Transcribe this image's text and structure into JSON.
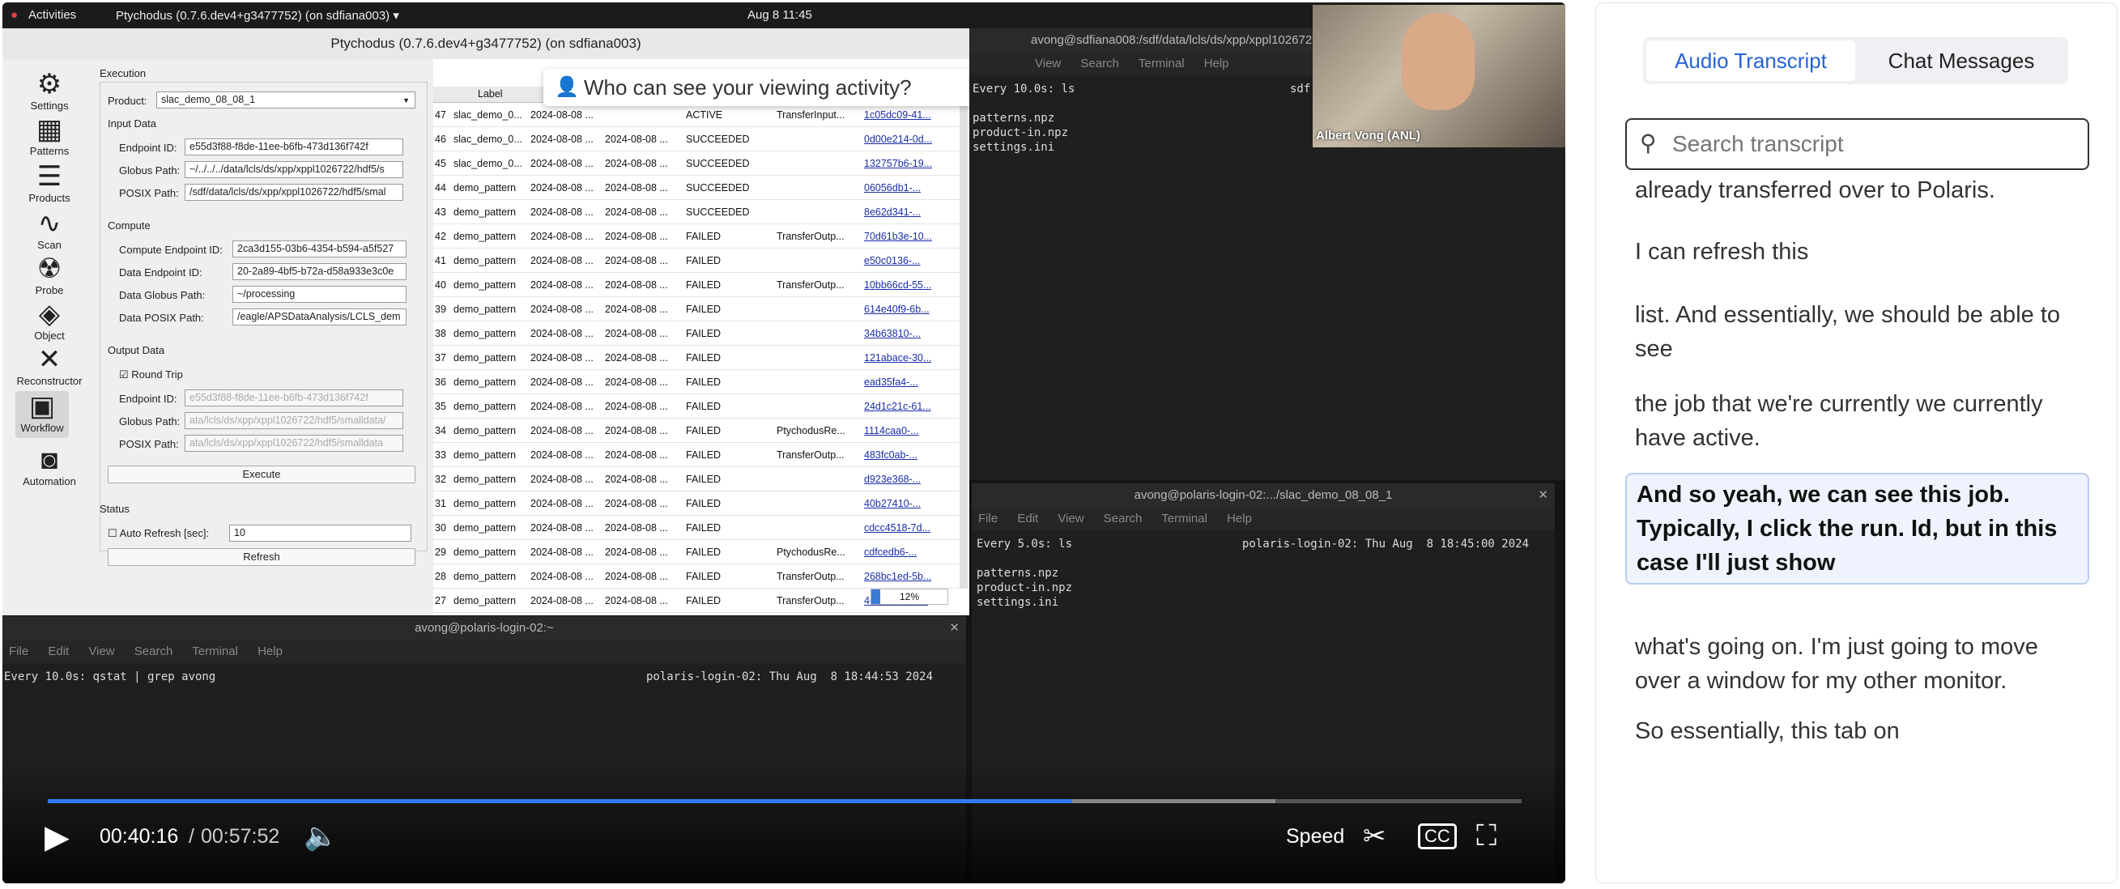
{
  "topbar": {
    "activities": "Activities",
    "app_menu": "Ptychodus (0.7.6.dev4+g3477752) (on sdfiana003) ▾",
    "clock": "Aug 8  11:45"
  },
  "app": {
    "title": "Ptychodus (0.7.6.dev4+g3477752) (on sdfiana003)",
    "sidebar": [
      {
        "label": "Settings",
        "icon": "gear-icon"
      },
      {
        "label": "Patterns",
        "icon": "grid-icon"
      },
      {
        "label": "Products",
        "icon": "list-icon"
      },
      {
        "label": "Scan",
        "icon": "scan-path-icon"
      },
      {
        "label": "Probe",
        "icon": "radiation-icon"
      },
      {
        "label": "Object",
        "icon": "layers-icon"
      },
      {
        "label": "Reconstructor",
        "icon": "tools-icon"
      },
      {
        "label": "Workflow",
        "icon": "briefcase-icon"
      },
      {
        "label": "Automation",
        "icon": "robot-icon"
      }
    ],
    "form": {
      "execution": "Execution",
      "product_label": "Product:",
      "product_value": "slac_demo_08_08_1",
      "input_data": "Input Data",
      "endpoint_id_label": "Endpoint ID:",
      "endpoint_id": "e55d3f88-f8de-11ee-b6fb-473d136f742f",
      "globus_path_label": "Globus Path:",
      "globus_path": "~/../../../data/lcls/ds/xpp/xppl1026722/hdf5/s",
      "posix_path_label": "POSIX Path:",
      "posix_path": "/sdf/data/lcls/ds/xpp/xppl1026722/hdf5/smal",
      "compute": "Compute",
      "compute_endpoint_label": "Compute Endpoint ID:",
      "compute_endpoint": "2ca3d155-03b6-4354-b594-a5f527",
      "data_endpoint_label": "Data Endpoint ID:",
      "data_endpoint": "20-2a89-4bf5-b72a-d58a933e3c0e",
      "data_globus_label": "Data Globus Path:",
      "data_globus": "~/processing",
      "data_posix_label": "Data POSIX Path:",
      "data_posix": "/eagle/APSDataAnalysis/LCLS_dem",
      "output_data": "Output Data",
      "round_trip": "Round Trip",
      "out_endpoint_label": "Endpoint ID:",
      "out_endpoint": "e55d3f88-f8de-11ee-b6fb-473d136f742f",
      "out_globus_label": "Globus Path:",
      "out_globus": "ata/lcls/ds/xpp/xppl1026722/hdf5/smalldata/",
      "out_posix_label": "POSIX Path:",
      "out_posix": "ata/lcls/ds/xpp/xppl1026722/hdf5/smalldata",
      "execute": "Execute",
      "status": "Status",
      "auto_refresh": "Auto Refresh [sec]:",
      "auto_refresh_value": "10",
      "refresh": "Refresh"
    },
    "table": {
      "header_label": "Label",
      "progress": "12%",
      "rows": [
        [
          "47",
          "slac_demo_0...",
          "2024-08-08 ...",
          "",
          "ACTIVE",
          "TransferInput...",
          "1c05dc09-41..."
        ],
        [
          "46",
          "slac_demo_0...",
          "2024-08-08 ...",
          "2024-08-08 ...",
          "SUCCEEDED",
          "",
          "0d00e214-0d..."
        ],
        [
          "45",
          "slac_demo_0...",
          "2024-08-08 ...",
          "2024-08-08 ...",
          "SUCCEEDED",
          "",
          "132757b6-19..."
        ],
        [
          "44",
          "demo_pattern",
          "2024-08-08 ...",
          "2024-08-08 ...",
          "SUCCEEDED",
          "",
          "06056db1-..."
        ],
        [
          "43",
          "demo_pattern",
          "2024-08-08 ...",
          "2024-08-08 ...",
          "SUCCEEDED",
          "",
          "8e62d341-..."
        ],
        [
          "42",
          "demo_pattern",
          "2024-08-08 ...",
          "2024-08-08 ...",
          "FAILED",
          "TransferOutp...",
          "70d61b3e-10..."
        ],
        [
          "41",
          "demo_pattern",
          "2024-08-08 ...",
          "2024-08-08 ...",
          "FAILED",
          "",
          "e50c0136-..."
        ],
        [
          "40",
          "demo_pattern",
          "2024-08-08 ...",
          "2024-08-08 ...",
          "FAILED",
          "TransferOutp...",
          "10bb66cd-55..."
        ],
        [
          "39",
          "demo_pattern",
          "2024-08-08 ...",
          "2024-08-08 ...",
          "FAILED",
          "",
          "614e40f9-6b..."
        ],
        [
          "38",
          "demo_pattern",
          "2024-08-08 ...",
          "2024-08-08 ...",
          "FAILED",
          "",
          "34b63810-..."
        ],
        [
          "37",
          "demo_pattern",
          "2024-08-08 ...",
          "2024-08-08 ...",
          "FAILED",
          "",
          "121abace-30..."
        ],
        [
          "36",
          "demo_pattern",
          "2024-08-08 ...",
          "2024-08-08 ...",
          "FAILED",
          "",
          "ead35fa4-..."
        ],
        [
          "35",
          "demo_pattern",
          "2024-08-08 ...",
          "2024-08-08 ...",
          "FAILED",
          "",
          "24d1c21c-61..."
        ],
        [
          "34",
          "demo_pattern",
          "2024-08-08 ...",
          "2024-08-08 ...",
          "FAILED",
          "PtychodusRe...",
          "1114caa0-..."
        ],
        [
          "33",
          "demo_pattern",
          "2024-08-08 ...",
          "2024-08-08 ...",
          "FAILED",
          "TransferOutp...",
          "483fc0ab-..."
        ],
        [
          "32",
          "demo_pattern",
          "2024-08-08 ...",
          "2024-08-08 ...",
          "FAILED",
          "",
          "d923e368-..."
        ],
        [
          "31",
          "demo_pattern",
          "2024-08-08 ...",
          "2024-08-08 ...",
          "FAILED",
          "",
          "40b27410-..."
        ],
        [
          "30",
          "demo_pattern",
          "2024-08-08 ...",
          "2024-08-08 ...",
          "FAILED",
          "",
          "cdcc4518-7d..."
        ],
        [
          "29",
          "demo_pattern",
          "2024-08-08 ...",
          "2024-08-08 ...",
          "FAILED",
          "PtychodusRe...",
          "cdfcedb6-..."
        ],
        [
          "28",
          "demo_pattern",
          "2024-08-08 ...",
          "2024-08-08 ...",
          "FAILED",
          "TransferOutp...",
          "268bc1ed-5b..."
        ],
        [
          "27",
          "demo_pattern",
          "2024-08-08 ...",
          "2024-08-08 ...",
          "FAILED",
          "TransferOutp...",
          "4612d9cf-2c..."
        ]
      ]
    }
  },
  "popup": {
    "text": "Who can see your viewing activity?",
    "close": "✕"
  },
  "term_top": {
    "title": "avong@sdfiana008:/sdf/data/lcls/ds/xpp/xppl1026722/",
    "menu": [
      "View",
      "Search",
      "Terminal",
      "Help"
    ],
    "command": "Every 10.0s: ls",
    "host": "sdf",
    "output": "patterns.npz\nproduct-in.npz\nsettings.ini"
  },
  "term_right": {
    "title": "avong@polaris-login-02:.../slac_demo_08_08_1",
    "menu": [
      "File",
      "Edit",
      "View",
      "Search",
      "Terminal",
      "Help"
    ],
    "command": "Every 5.0s: ls",
    "timestamp": "polaris-login-02: Thu Aug  8 18:45:00 2024",
    "output": "patterns.npz\nproduct-in.npz\nsettings.ini"
  },
  "term_bottom": {
    "title": "avong@polaris-login-02:~",
    "menu": [
      "File",
      "Edit",
      "View",
      "Search",
      "Terminal",
      "Help"
    ],
    "command": "Every 10.0s: qstat | grep avong",
    "timestamp": "polaris-login-02: Thu Aug  8 18:44:53 2024"
  },
  "webcam": {
    "name": "Albert Vong (ANL)"
  },
  "player": {
    "current": "00:40:16",
    "separator": "/",
    "duration": "00:57:52",
    "speed": "Speed",
    "progress_fraction": 0.695,
    "buffered_fraction": 0.833
  },
  "transcript": {
    "tab_audio": "Audio Transcript",
    "tab_chat": "Chat Messages",
    "search_placeholder": "Search transcript",
    "lines": [
      "already transferred over to Polaris.",
      "I can refresh this",
      "list. And essentially, we should be able to see",
      "the job that we're currently we currently have active.",
      "And so yeah, we can see this job. Typically, I click the run. Id, but in this case I'll just show",
      "what's going on. I'm just going to move over a window for my other monitor.",
      "So essentially, this tab on"
    ],
    "active_index": 4
  },
  "colors": {
    "accent": "#2563d6",
    "active_bg": "#eef3fd",
    "active_border": "#b9cdf2"
  }
}
